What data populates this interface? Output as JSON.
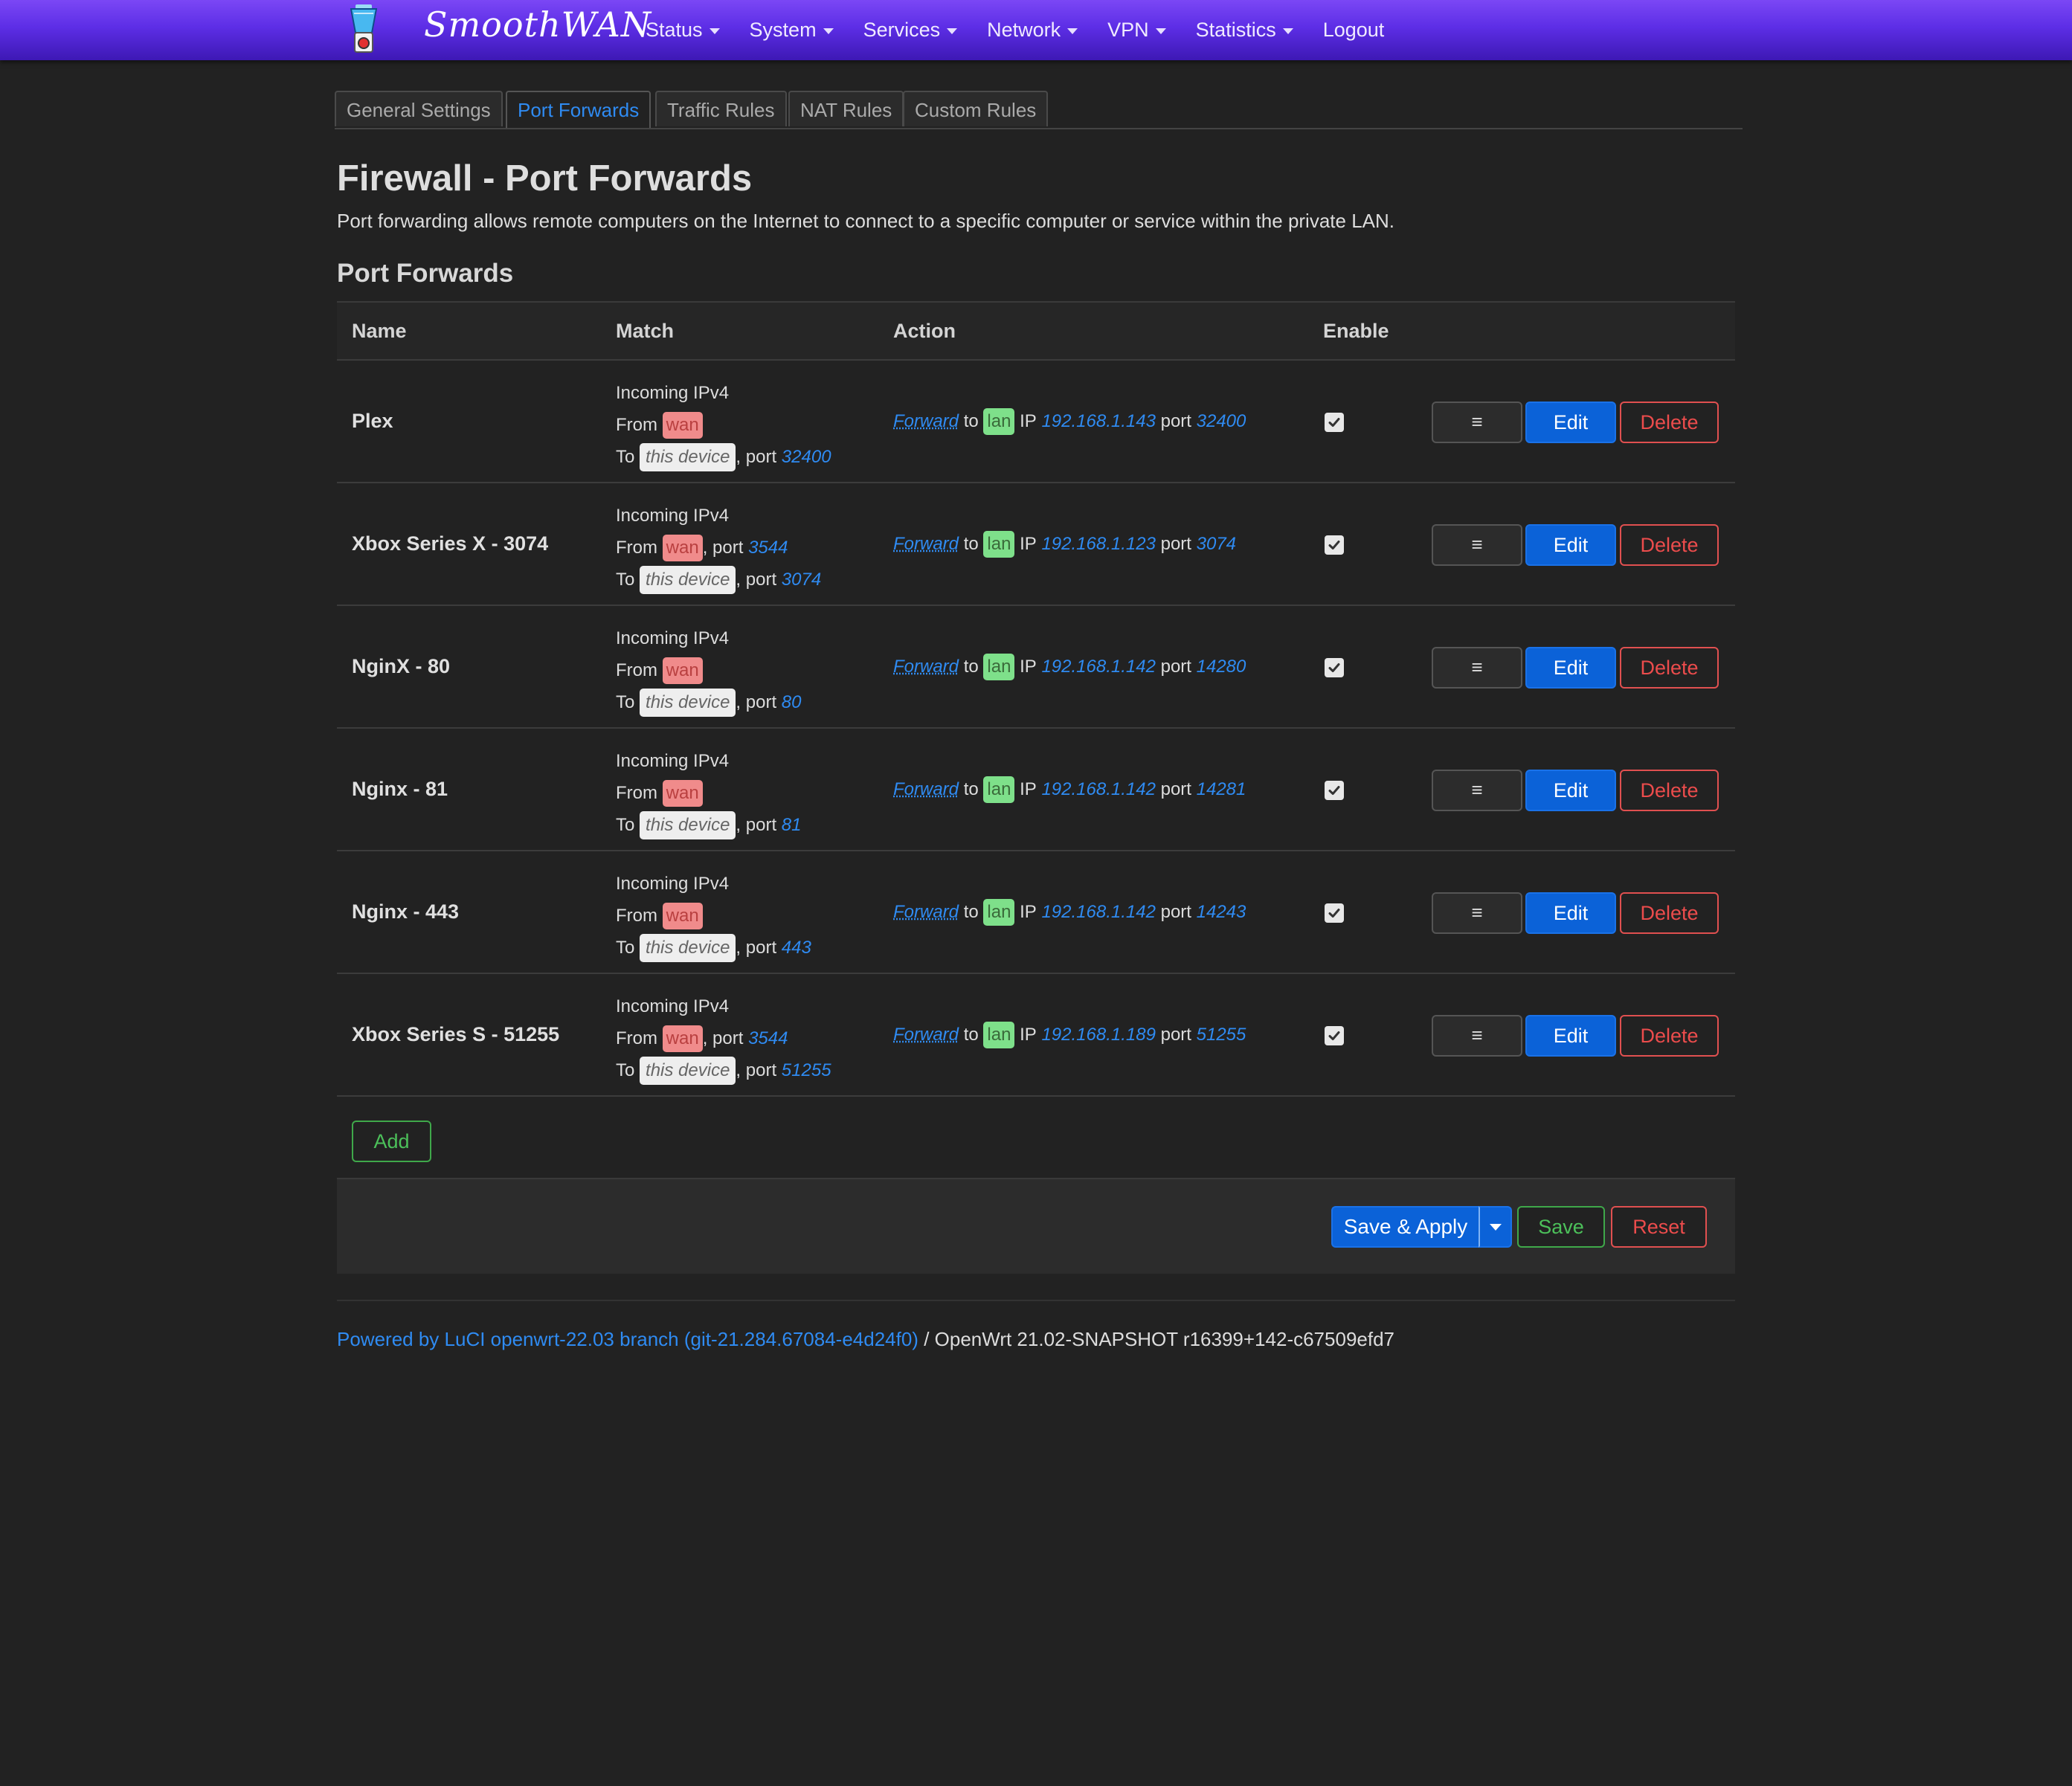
{
  "header": {
    "brand": "SmoothWAN",
    "nav": [
      {
        "label": "Status",
        "dropdown": true
      },
      {
        "label": "System",
        "dropdown": true
      },
      {
        "label": "Services",
        "dropdown": true
      },
      {
        "label": "Network",
        "dropdown": true
      },
      {
        "label": "VPN",
        "dropdown": true
      },
      {
        "label": "Statistics",
        "dropdown": true
      },
      {
        "label": "Logout",
        "dropdown": false
      }
    ]
  },
  "tabs": [
    {
      "label": "General Settings",
      "active": false
    },
    {
      "label": "Port Forwards",
      "active": true
    },
    {
      "label": "Traffic Rules",
      "active": false
    },
    {
      "label": "NAT Rules",
      "active": false
    },
    {
      "label": "Custom Rules",
      "active": false
    }
  ],
  "page": {
    "title": "Firewall - Port Forwards",
    "description": "Port forwarding allows remote computers on the Internet to connect to a specific computer or service within the private LAN.",
    "section_title": "Port Forwards"
  },
  "table": {
    "columns": [
      "Name",
      "Match",
      "Action",
      "Enable"
    ],
    "text": {
      "incoming": "Incoming IPv4",
      "from": "From",
      "to": "To",
      "port": "port",
      "wan": "wan",
      "this_device": "this device",
      "forward": "Forward",
      "to_lower": "to",
      "lan": "lan",
      "ip": "IP"
    },
    "rows": [
      {
        "name": "Plex",
        "src_port": null,
        "dest_port": "32400",
        "ip": "192.168.1.143",
        "fwd_port": "32400",
        "enabled": true
      },
      {
        "name": "Xbox Series X - 3074",
        "src_port": "3544",
        "dest_port": "3074",
        "ip": "192.168.1.123",
        "fwd_port": "3074",
        "enabled": true
      },
      {
        "name": "NginX - 80",
        "src_port": null,
        "dest_port": "80",
        "ip": "192.168.1.142",
        "fwd_port": "14280",
        "enabled": true
      },
      {
        "name": "Nginx - 81",
        "src_port": null,
        "dest_port": "81",
        "ip": "192.168.1.142",
        "fwd_port": "14281",
        "enabled": true
      },
      {
        "name": "Nginx - 443",
        "src_port": null,
        "dest_port": "443",
        "ip": "192.168.1.142",
        "fwd_port": "14243",
        "enabled": true
      },
      {
        "name": "Xbox Series S - 51255",
        "src_port": "3544",
        "dest_port": "51255",
        "ip": "192.168.1.189",
        "fwd_port": "51255",
        "enabled": true
      }
    ],
    "buttons": {
      "menu": "≡",
      "edit": "Edit",
      "delete": "Delete"
    }
  },
  "add_label": "Add",
  "actions": {
    "save_apply": "Save & Apply",
    "save": "Save",
    "reset": "Reset"
  },
  "footer": {
    "link": "Powered by LuCI openwrt-22.03 branch (git-21.284.67084-e4d24f0)",
    "text": " / OpenWrt 21.02-SNAPSHOT r16399+142-c67509efd7"
  },
  "colors": {
    "header_gradient_top": "#7b47f5",
    "header_gradient_bottom": "#3d18b4",
    "accent": "#2f8bf2",
    "primary_button": "#0b62d8",
    "danger": "#ec4c4c",
    "success": "#4cc05a",
    "wan_badge": "#f08b8b",
    "lan_badge": "#7ee08a"
  }
}
